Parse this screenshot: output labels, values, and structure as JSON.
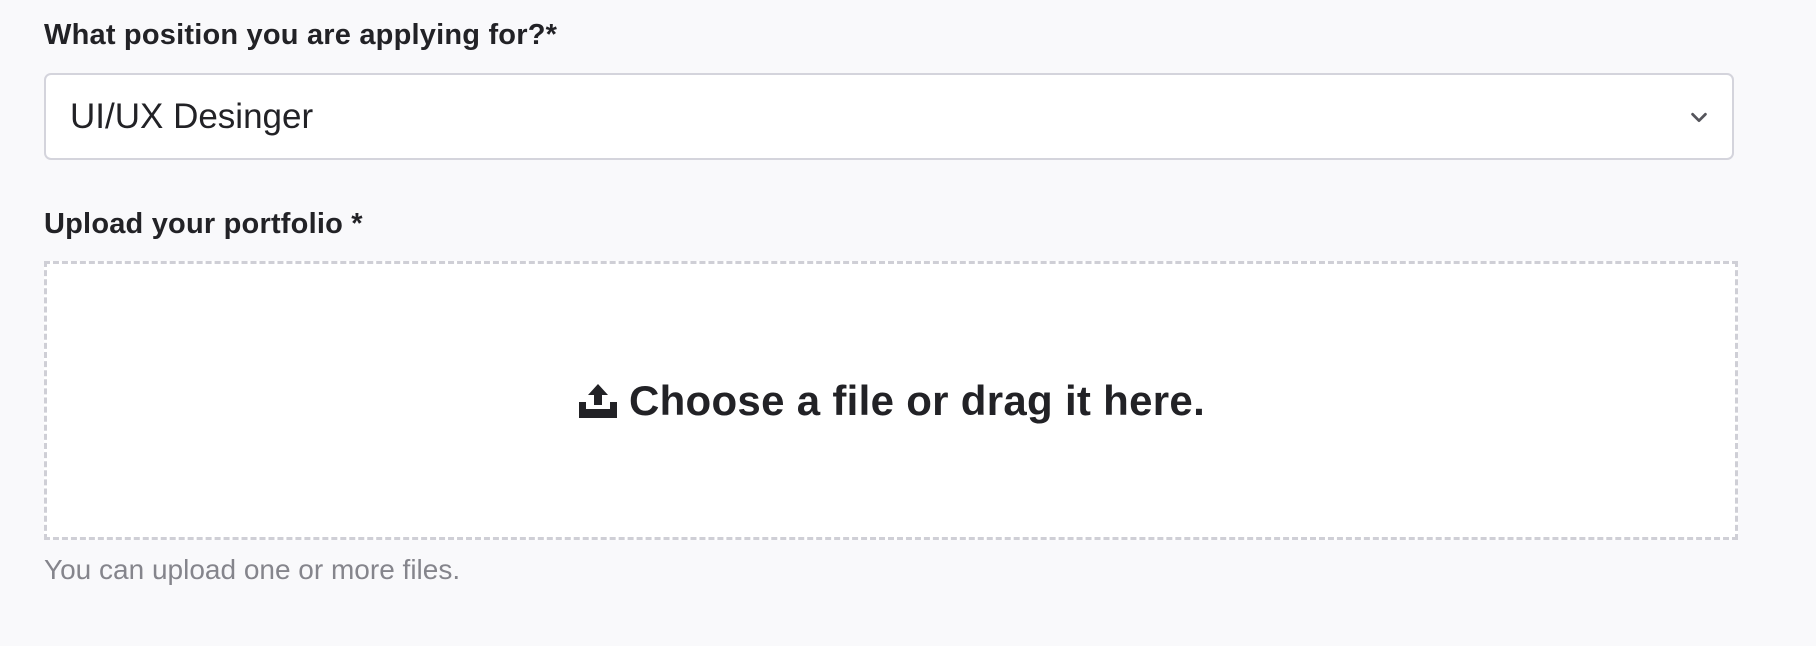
{
  "position_field": {
    "label": "What position you are applying for?*",
    "selected_value": "UI/UX Desinger",
    "chevron_icon": "chevron-down-icon"
  },
  "upload_field": {
    "label": "Upload your portfolio *",
    "dropzone_text": "Choose a file or drag it here.",
    "upload_icon": "upload-icon",
    "helper_text": "You can upload one or more files."
  },
  "colors": {
    "background": "#f9f9fb",
    "text": "#222226",
    "border": "#d4d4dc",
    "dashed_border": "#cfcfd6",
    "helper_text": "#85858c"
  }
}
